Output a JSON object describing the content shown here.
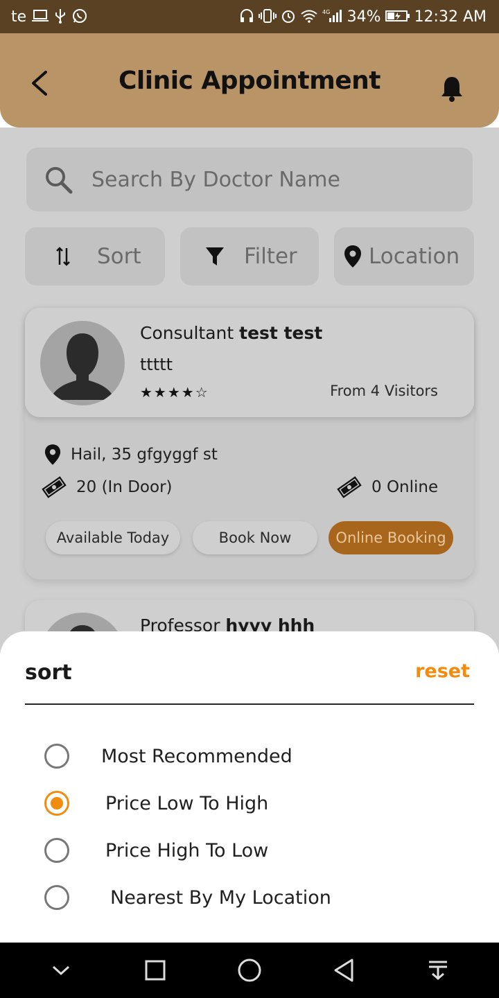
{
  "status_bar": {
    "left_text": "te",
    "battery": "34%",
    "network": "4G",
    "time": "12:32 AM"
  },
  "header": {
    "title": "Clinic Appointment"
  },
  "search": {
    "placeholder": "Search By Doctor Name"
  },
  "filters": {
    "sort_label": "Sort",
    "filter_label": "Filter",
    "location_label": "Location"
  },
  "doctors": [
    {
      "title": "Consultant",
      "name": "test test",
      "specialty": "ttttt",
      "stars": "★★★★☆",
      "rating_value": 4,
      "visitors": "From 4 Visitors",
      "address": "Hail, 35 gfgyggf st",
      "in_door_price": "20 (In Door)",
      "online_price": "0 Online",
      "available_label": "Available Today",
      "book_label": "Book Now",
      "online_booking_label": "Online Booking"
    },
    {
      "title": "Professor",
      "name": "hyyy hhh"
    }
  ],
  "sort_sheet": {
    "title": "sort",
    "reset_label": "reset",
    "options": [
      {
        "label": "Most Recommended",
        "selected": false
      },
      {
        "label": "Price Low To High",
        "selected": true
      },
      {
        "label": "Price High To Low",
        "selected": false
      },
      {
        "label": "Nearest By My Location",
        "selected": false
      }
    ]
  },
  "colors": {
    "accent": "#f28c0f",
    "header_bg": "#b89467",
    "status_bar_bg": "#5a4124"
  }
}
